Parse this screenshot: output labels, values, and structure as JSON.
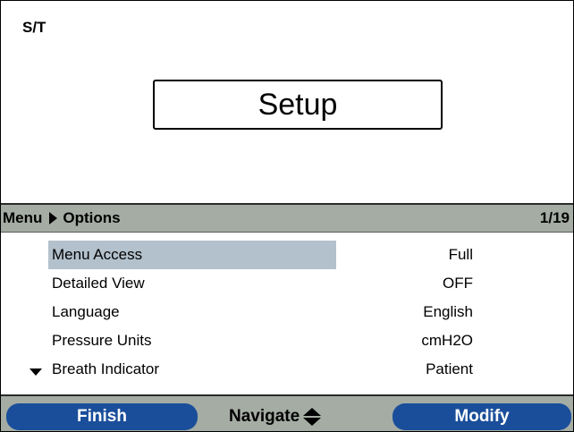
{
  "status": {
    "mode": "S/T"
  },
  "title": {
    "label": "Setup"
  },
  "breadcrumb": {
    "root": "Menu",
    "current": "Options",
    "page": "1/19"
  },
  "menu": {
    "items": [
      {
        "label": "Menu Access",
        "value": "Full",
        "selected": true
      },
      {
        "label": "Detailed View",
        "value": "OFF",
        "selected": false
      },
      {
        "label": "Language",
        "value": "English",
        "selected": false
      },
      {
        "label": "Pressure Units",
        "value": "cmH2O",
        "selected": false
      },
      {
        "label": "Breath Indicator",
        "value": "Patient",
        "selected": false
      }
    ],
    "scroll_icon": "triangle-down-icon"
  },
  "softkeys": {
    "left": "Finish",
    "center": "Navigate",
    "center_icon": "up-down-arrows-icon",
    "right": "Modify"
  },
  "colors": {
    "bar_gray": "#a4aca4",
    "softkey_blue": "#1a4e9a",
    "selection": "#b3c1cc"
  }
}
